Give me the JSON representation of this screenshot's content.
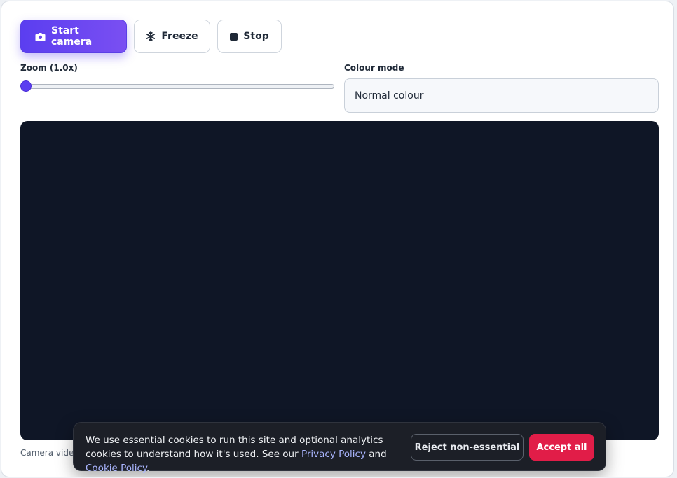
{
  "toolbar": {
    "start_label": "Start camera",
    "freeze_label": "Freeze",
    "stop_label": "Stop",
    "start_icon": "camera-icon",
    "freeze_icon": "snowflake-icon",
    "stop_icon": "stop-square-icon"
  },
  "zoom": {
    "label": "Zoom (1.0x)",
    "value": 1.0,
    "level_fraction": 0.0
  },
  "colour_mode": {
    "label": "Colour mode",
    "selected": "Normal colour"
  },
  "caption": "Camera video",
  "cookie_banner": {
    "text_before": "We use essential cookies to run this site and optional analytics cookies to understand how it's used. See our ",
    "privacy_link": "Privacy Policy",
    "and_text": " and ",
    "cookie_link": "Cookie Policy",
    "text_after": ".",
    "reject_label": "Reject non-essential",
    "accept_label": "Accept all"
  },
  "colors": {
    "primary": "#5b3ef0",
    "video_bg": "#0f1626",
    "banner_bg": "#1c1f27",
    "accept": "#e11d48",
    "link": "#aab6ff"
  }
}
